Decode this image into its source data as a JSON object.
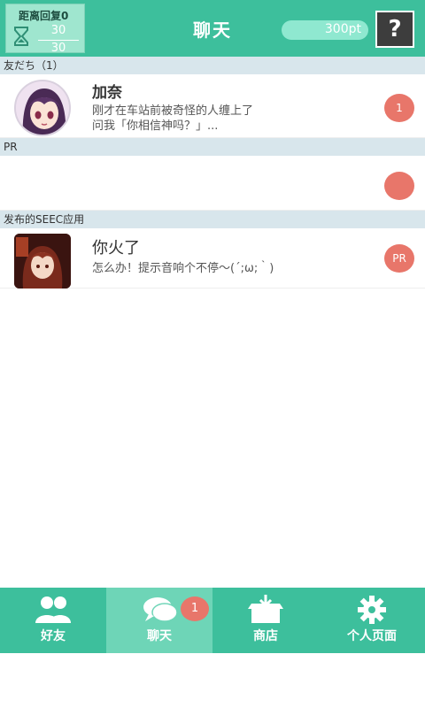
{
  "header": {
    "recover_label": "距离回复0",
    "recover_current": "30",
    "recover_max": "30",
    "title": "聊天",
    "points": "300pt",
    "help": "?"
  },
  "sections": {
    "friends": "友だち（1）",
    "pr": "PR",
    "apps": "发布的SEEC应用"
  },
  "friend_row": {
    "name": "加奈",
    "message_line1": "刚才在车站前被奇怪的人缠上了",
    "message_line2": "问我「你相信神吗？」...",
    "badge": "1"
  },
  "pr_row": {
    "badge": ""
  },
  "app_row": {
    "name": "你火了",
    "message": "怎么办！提示音响个不停～(´;ω;｀)",
    "badge": "PR"
  },
  "nav": {
    "items": [
      {
        "label": "好友",
        "icon": "friends-icon"
      },
      {
        "label": "聊天",
        "icon": "chat-icon",
        "badge": "1"
      },
      {
        "label": "商店",
        "icon": "shop-icon"
      },
      {
        "label": "个人页面",
        "icon": "gear-icon"
      }
    ],
    "active_index": 1
  },
  "colors": {
    "primary": "#3dbf9c",
    "active_tab": "#6ed5b7",
    "badge": "#e8766a",
    "section": "#d8e6ec"
  }
}
